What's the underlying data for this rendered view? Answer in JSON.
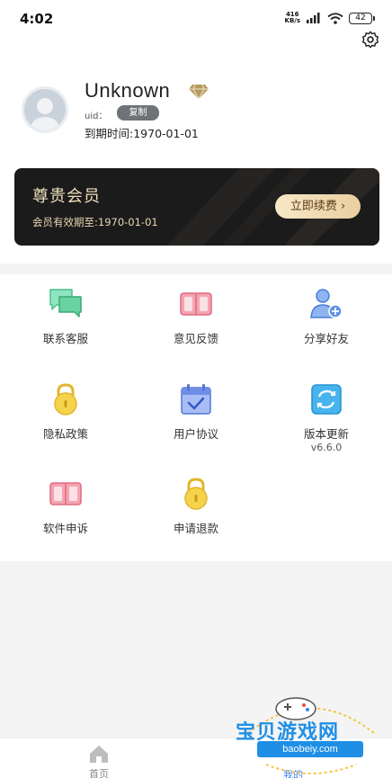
{
  "status_bar": {
    "time": "4:02",
    "net_speed_value": "416",
    "net_speed_unit": "KB/s",
    "battery": "42"
  },
  "profile": {
    "username": "Unknown",
    "uid_label": "uid：",
    "copy_label": "复制",
    "expiry_text": "到期时间:1970-01-01"
  },
  "vip_card": {
    "title": "尊贵会员",
    "validity_text": "会员有效期至:1970-01-01",
    "renew_label": "立即续费",
    "renew_arrow": "›"
  },
  "grid": {
    "contact_service": "联系客服",
    "feedback": "意见反馈",
    "share_friends": "分享好友",
    "privacy_policy": "隐私政策",
    "user_agreement": "用户协议",
    "version_update": "版本更新",
    "version": "v6.6.0",
    "software_appeal": "软件申诉",
    "refund_request": "申请退款"
  },
  "tab_bar": {
    "home": "首页",
    "mine": "我的"
  },
  "watermark": {
    "title": "宝贝游戏网",
    "url": "baobeiy.com"
  },
  "colors": {
    "accent_blue": "#3b82f6",
    "card_bg": "#1b1b1b",
    "card_gold": "#f1dfbd",
    "green_icon": "#5fd6a0",
    "pink_icon": "#ef7b8e",
    "yellow_icon": "#f5d24a"
  }
}
